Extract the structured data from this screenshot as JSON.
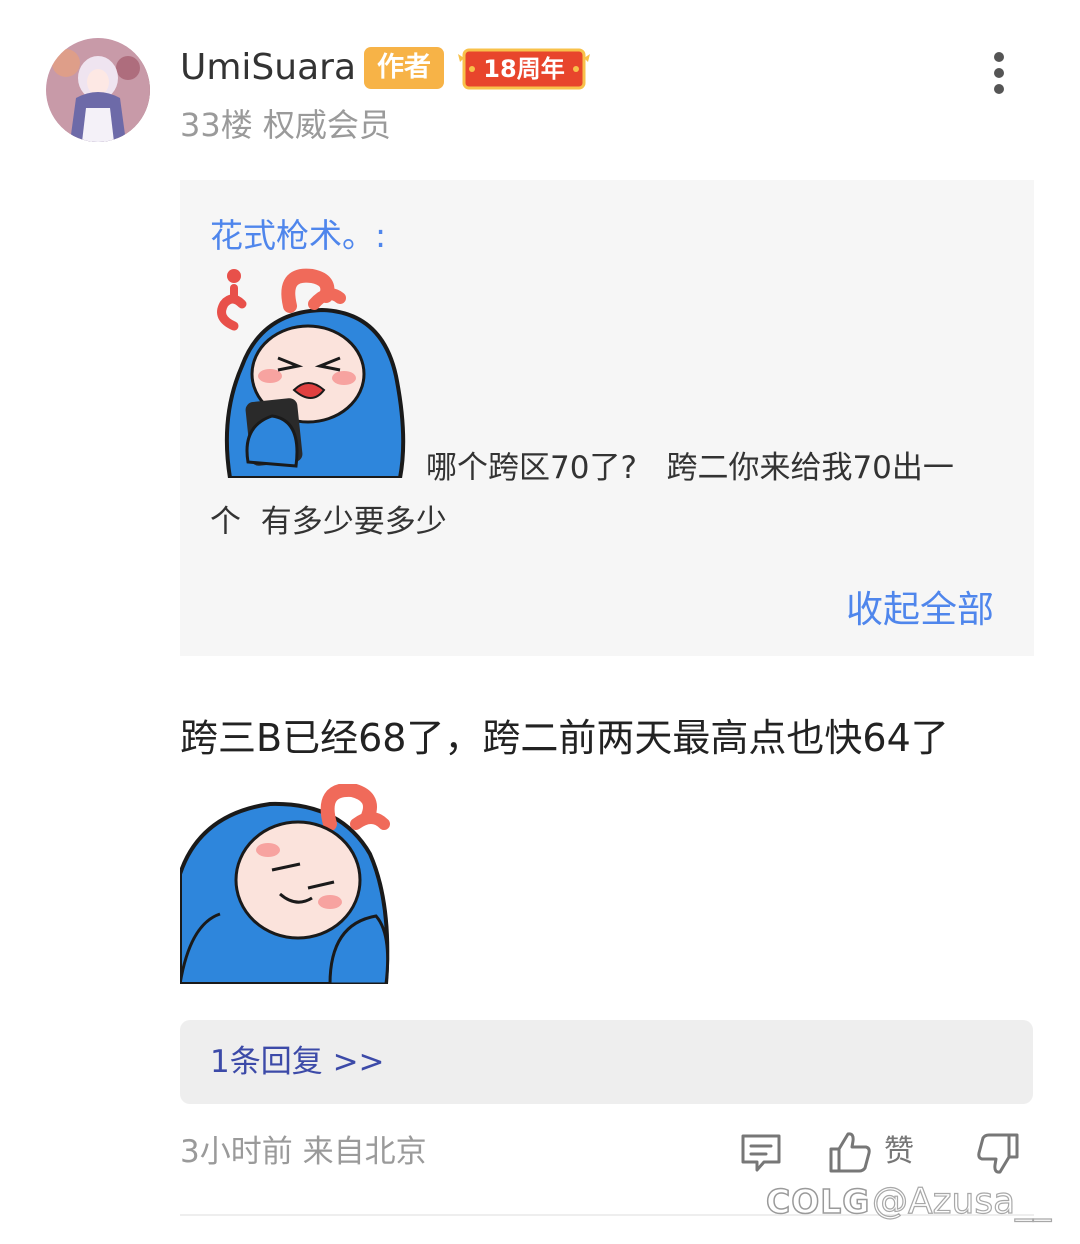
{
  "post": {
    "username": "UmiSuara",
    "author_badge": "作者",
    "anniversary_badge": "18周年",
    "meta": "33楼 权威会员"
  },
  "quote": {
    "author": "花式枪术。:",
    "text_line1": "哪个跨区70了?   跨二你来给我70出一",
    "text_line2": "个  有多少要多少",
    "collapse_label": "收起全部"
  },
  "main": {
    "text": "跨三B已经68了，跨二前两天最高点也快64了"
  },
  "replies": {
    "label": "1条回复 >>"
  },
  "footer": {
    "time_location": "3小时前 来自北京",
    "like_label": "赞"
  },
  "watermark": {
    "logo": "COLG",
    "handle": "@Azusa__"
  },
  "colors": {
    "accent_blue": "#4f86ec",
    "reply_link": "#3c4aa8",
    "author_badge": "#f7b347",
    "anniversary_badge": "#e8452c"
  },
  "icons": [
    "more-vertical-icon",
    "comment-icon",
    "thumbs-up-icon",
    "thumbs-down-icon"
  ]
}
